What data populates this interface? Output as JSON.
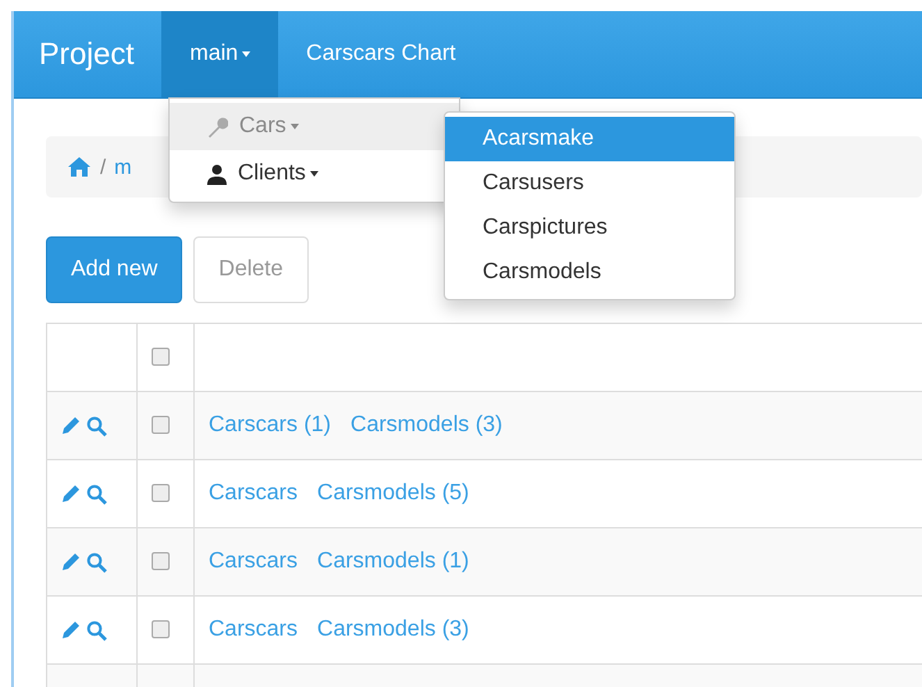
{
  "navbar": {
    "brand": "Project",
    "items": [
      {
        "label": "main",
        "caret": true,
        "selected": true
      },
      {
        "label": "Carscars Chart",
        "caret": false,
        "selected": false
      }
    ]
  },
  "breadcrumb": {
    "items": [
      "/",
      "m"
    ]
  },
  "main_menu": {
    "items": [
      {
        "label": "Cars",
        "selected": true
      },
      {
        "label": "Clients",
        "selected": false
      }
    ]
  },
  "submenu": {
    "items": [
      {
        "label": "Acarsmake",
        "selected": true
      },
      {
        "label": "Carsusers",
        "selected": false
      },
      {
        "label": "Carspictures",
        "selected": false
      },
      {
        "label": "Carsmodels",
        "selected": false
      }
    ]
  },
  "buttons": [
    {
      "label": "Add new",
      "kind": "primary"
    },
    {
      "label": "Delete",
      "kind": "default"
    }
  ],
  "table": {
    "header": {
      "checked": false
    },
    "rows": [
      {
        "checked": false,
        "links": [
          "Carscars (1)",
          "Carsmodels (3)"
        ]
      },
      {
        "checked": false,
        "links": [
          "Carscars",
          "Carsmodels (5)"
        ]
      },
      {
        "checked": false,
        "links": [
          "Carscars",
          "Carsmodels (1)"
        ]
      },
      {
        "checked": false,
        "links": [
          "Carscars",
          "Carsmodels (3)"
        ]
      },
      {
        "links": []
      }
    ]
  }
}
